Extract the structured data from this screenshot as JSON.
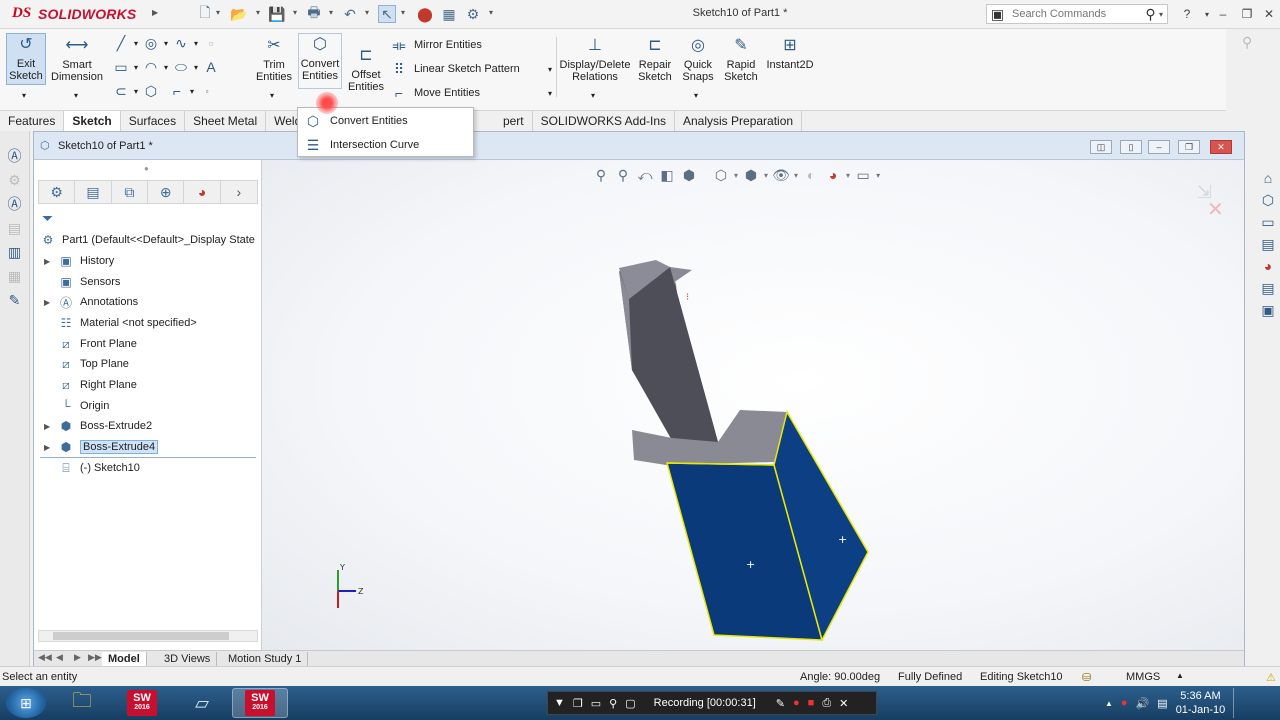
{
  "app": {
    "brand": "SOLIDWORKS",
    "brand_mark": "DS",
    "doc_title": "Sketch10 of Part1 *",
    "search_placeholder": "Search Commands"
  },
  "ribbon": {
    "exit_sketch": "Exit\nSketch",
    "smart_dimension": "Smart\nDimension",
    "trim_entities": "Trim\nEntities",
    "convert_entities": "Convert\nEntities",
    "offset_entities": "Offset\nEntities",
    "mirror_entities": "Mirror Entities",
    "linear_sketch_pattern": "Linear Sketch Pattern",
    "move_entities": "Move Entities",
    "display_delete_relations": "Display/Delete\nRelations",
    "repair_sketch": "Repair\nSketch",
    "quick_snaps": "Quick\nSnaps",
    "rapid_sketch": "Rapid\nSketch",
    "instant2d": "Instant2D"
  },
  "tabs": [
    "Features",
    "Sketch",
    "Surfaces",
    "Sheet Metal",
    "Weldment",
    "pert",
    "SOLIDWORKS Add-Ins",
    "Analysis Preparation"
  ],
  "dropdown": {
    "items": [
      "Convert Entities",
      "Intersection Curve"
    ]
  },
  "doc_window": {
    "title": "Sketch10 of Part1 *"
  },
  "tree": {
    "root": "Part1  (Default<<Default>_Display State",
    "items": [
      {
        "label": "History",
        "icon": "folder-icon",
        "expandable": true
      },
      {
        "label": "Sensors",
        "icon": "sensor-icon",
        "expandable": false
      },
      {
        "label": "Annotations",
        "icon": "annotation-icon",
        "expandable": true
      },
      {
        "label": "Material <not specified>",
        "icon": "material-icon",
        "expandable": false
      },
      {
        "label": "Front Plane",
        "icon": "plane-icon",
        "expandable": false
      },
      {
        "label": "Top Plane",
        "icon": "plane-icon",
        "expandable": false
      },
      {
        "label": "Right Plane",
        "icon": "plane-icon",
        "expandable": false
      },
      {
        "label": "Origin",
        "icon": "origin-icon",
        "expandable": false
      },
      {
        "label": "Boss-Extrude2",
        "icon": "extrude-icon",
        "expandable": true
      },
      {
        "label": "Boss-Extrude4",
        "icon": "extrude-icon",
        "expandable": true,
        "selected": true
      },
      {
        "label": "(-) Sketch10",
        "icon": "sketch-icon",
        "expandable": false
      }
    ]
  },
  "bottom_tabs": [
    "Model",
    "3D Views",
    "Motion Study 1"
  ],
  "status": {
    "left": "Select an entity",
    "angle": "Angle: 90.00deg",
    "defined": "Fully Defined",
    "editing": "Editing Sketch10",
    "units": "MMGS"
  },
  "taskbar": {
    "sw_label": "SW",
    "sw_year": "2016",
    "recording": "Recording [00:00:31]",
    "time": "5:36 AM",
    "date": "01-Jan-10"
  },
  "colors": {
    "brand_red": "#c8102e",
    "face_blue": "#0a3a7a",
    "edge_yellow": "#e8e800",
    "taskbar": "#1f4b75"
  }
}
